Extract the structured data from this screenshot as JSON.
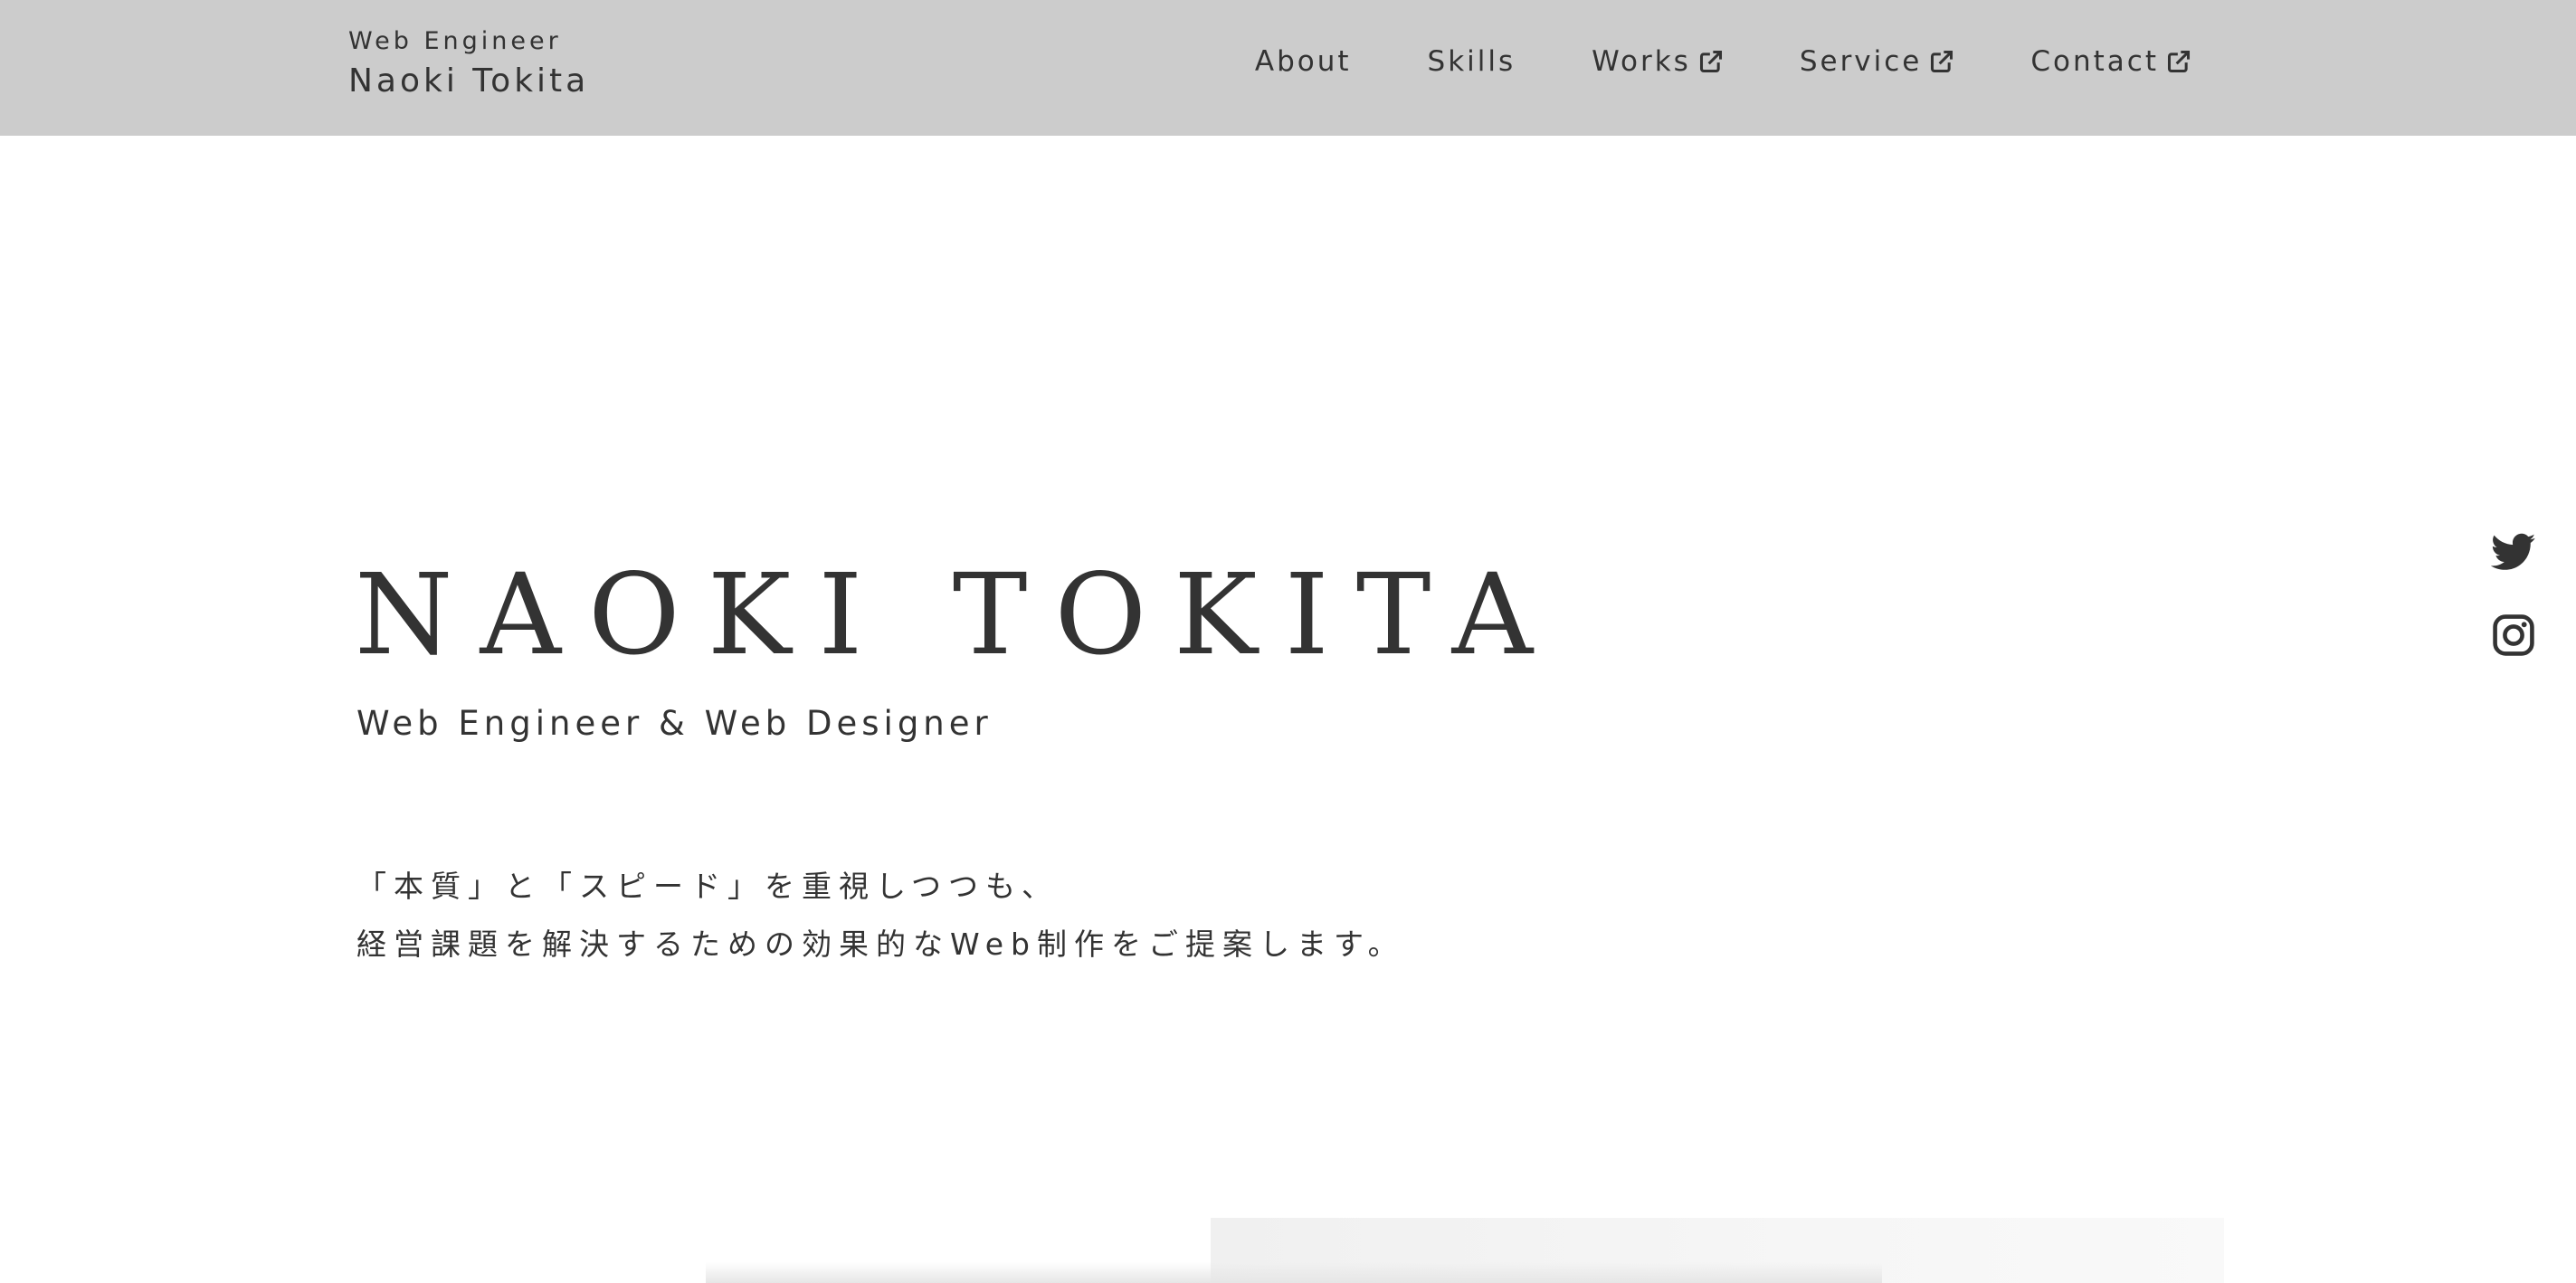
{
  "header": {
    "brand_tag": "Web Engineer",
    "brand_name": "Naoki Tokita",
    "background": "#cccccc",
    "nav": [
      {
        "label": "About",
        "external": false
      },
      {
        "label": "Skills",
        "external": false
      },
      {
        "label": "Works",
        "external": true,
        "icon": "external-link-icon"
      },
      {
        "label": "Service",
        "external": true,
        "icon": "external-link-icon"
      },
      {
        "label": "Contact",
        "external": true,
        "icon": "external-link-icon"
      }
    ]
  },
  "hero": {
    "title": "NAOKI TOKITA",
    "subtitle": "Web Engineer & Web Designer",
    "description": [
      "「本質」と「スピード」を重視しつつも、",
      "経営課題を解決するための効果的なWeb制作をご提案します。"
    ]
  },
  "social": [
    {
      "icon": "twitter-icon"
    },
    {
      "icon": "instagram-icon"
    }
  ],
  "colors": {
    "text": "#333333",
    "header_bg": "#cccccc",
    "page_bg": "#ffffff"
  }
}
